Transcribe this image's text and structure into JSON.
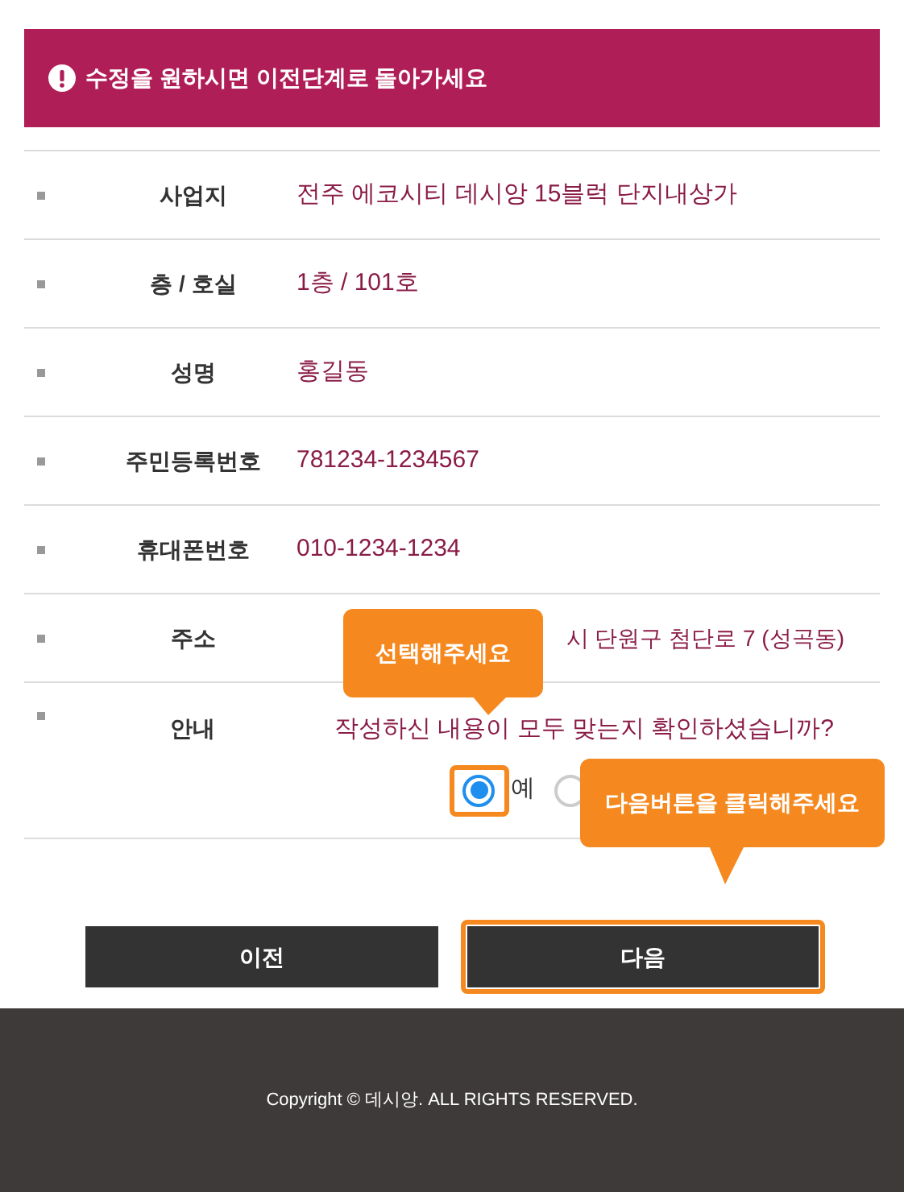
{
  "notice": "수정을 원하시면 이전단계로 돌아가세요",
  "rows": [
    {
      "label": "사업지",
      "value": "전주 에코시티 데시앙 15블럭 단지내상가",
      "kind": "text"
    },
    {
      "label": "층 / 호실",
      "value": "1층 / 101호",
      "kind": "text"
    },
    {
      "label": "성명",
      "value": "홍길동",
      "kind": "text"
    },
    {
      "label": "주민등록번호",
      "value": "781234-1234567",
      "kind": "text"
    },
    {
      "label": "휴대폰번호",
      "value": "010-1234-1234",
      "kind": "text"
    },
    {
      "label": "주소",
      "value": "시 단원구 첨단로 7 (성곡동)",
      "kind": "partial"
    },
    {
      "label": "안내",
      "value": "작성하신 내용이 모두 맞는지 확인하셨습니까?",
      "kind": "question"
    }
  ],
  "options": [
    {
      "label": "예",
      "selected": true
    },
    {
      "selected": false
    }
  ],
  "tooltips": [
    "선택해주세요",
    "다음버튼을 클릭해주세요"
  ],
  "buttons": [
    {
      "label": "이전",
      "highlighted": false
    },
    {
      "label": "다음",
      "highlighted": true
    }
  ],
  "footer": "Copyright © 데시앙. ALL RIGHTS RESERVED."
}
